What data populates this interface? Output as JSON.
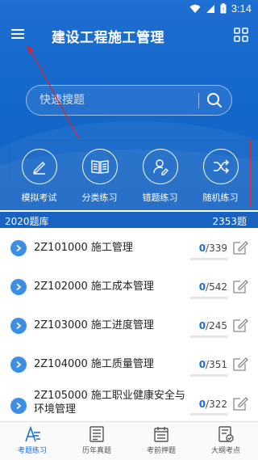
{
  "status": {
    "time": "3:14"
  },
  "header": {
    "title": "建设工程施工管理"
  },
  "search": {
    "placeholder": "快速搜题"
  },
  "quick_actions": [
    {
      "label": "模拟考试",
      "icon": "pencil-icon"
    },
    {
      "label": "分类练习",
      "icon": "book-icon"
    },
    {
      "label": "错题练习",
      "icon": "user-edit-icon"
    },
    {
      "label": "随机练习",
      "icon": "shuffle-icon"
    }
  ],
  "bank": {
    "year_label": "2020题库",
    "total_label": "2353题"
  },
  "chapters": [
    {
      "title": "2Z101000 施工管理",
      "done": "0",
      "total": "/339",
      "progress": 0
    },
    {
      "title": "2Z102000 施工成本管理",
      "done": "0",
      "total": "/542",
      "progress": 0
    },
    {
      "title": "2Z103000 施工进度管理",
      "done": "0",
      "total": "/245",
      "progress": 0
    },
    {
      "title": "2Z104000 施工质量管理",
      "done": "0",
      "total": "/351",
      "progress": 0
    },
    {
      "title": "2Z105000 施工职业健康安全与环境管理",
      "done": "0",
      "total": "/322",
      "progress": 0
    }
  ],
  "tabs": [
    {
      "label": "考题练习",
      "icon": "practice-icon",
      "active": true
    },
    {
      "label": "历年真题",
      "icon": "past-papers-icon",
      "active": false
    },
    {
      "label": "考前押题",
      "icon": "calendar-icon",
      "active": false
    },
    {
      "label": "大纲考点",
      "icon": "outline-icon",
      "active": false
    }
  ],
  "colors": {
    "primary": "#1e6ed2",
    "annotation": "#d9262c",
    "accent_light": "#3d8ee4"
  }
}
